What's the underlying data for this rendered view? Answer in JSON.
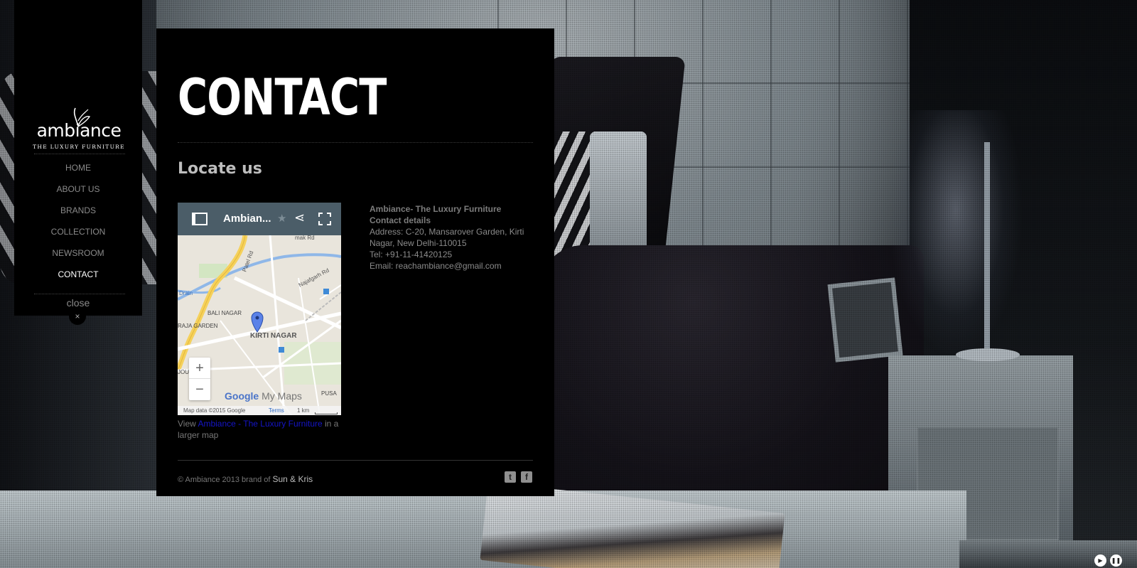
{
  "brand": {
    "name": "ambiance",
    "tagline": "THE LUXURY FURNITURE"
  },
  "nav": {
    "items": [
      {
        "label": "HOME",
        "active": false
      },
      {
        "label": "ABOUT US",
        "active": false
      },
      {
        "label": "BRANDS",
        "active": false
      },
      {
        "label": "COLLECTION",
        "active": false
      },
      {
        "label": "NEWSROOM",
        "active": false
      },
      {
        "label": "CONTACT",
        "active": true
      }
    ],
    "close_label": "close",
    "close_glyph": "×"
  },
  "page": {
    "title": "CONTACT",
    "section_title": "Locate us"
  },
  "map": {
    "header_title": "Ambian...",
    "places": [
      "Patel Rd",
      "Najafgarh Rd",
      "Drain",
      "BALI NAGAR",
      "RAJA GARDEN",
      "KIRTI NAGAR",
      "JOU",
      "PUSA",
      "mak Rd"
    ],
    "zoom_in": "+",
    "zoom_out": "−",
    "brand_google": "Google",
    "brand_mymaps": "My Maps",
    "attribution": "Map data ©2015 Google",
    "terms": "Terms",
    "scale": "1 km"
  },
  "map_link": {
    "prefix": "View ",
    "link_text": "Ambiance - The Luxury Furniture",
    "suffix": " in a larger map"
  },
  "contact": {
    "company": "Ambiance- The Luxury Furniture",
    "heading": "Contact details",
    "address": "Address: C-20, Mansarover Garden, Kirti Nagar, New Delhi-110015",
    "tel": "Tel: +91-11-41420125",
    "email": "Email: reachambiance@gmail.com"
  },
  "footer": {
    "copyright": "© Ambiance 2013 brand of ",
    "brand_link": "Sun & Kris",
    "twitter_glyph": "t",
    "facebook_glyph": "f"
  },
  "slideshow": {
    "play_glyph": "▶",
    "pause_glyph": "❚❚"
  }
}
